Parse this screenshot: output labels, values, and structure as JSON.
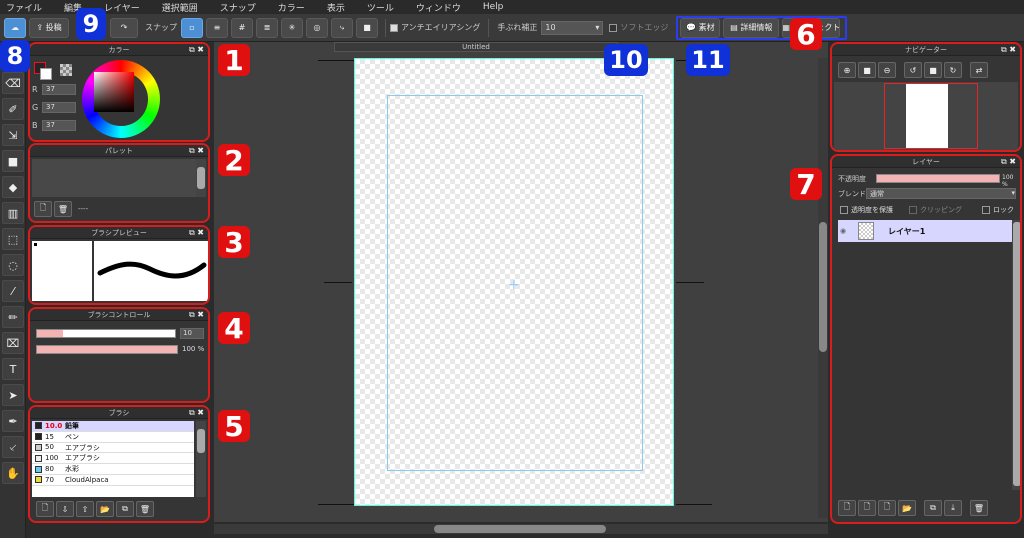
{
  "menu": [
    "ファイル",
    "編集",
    "レイヤー",
    "選択範囲",
    "スナップ",
    "カラー",
    "表示",
    "ツール",
    "ウィンドウ",
    "Help"
  ],
  "toolbar": {
    "post_label": "投稿",
    "snap_label": "スナップ",
    "antialias_label": "アンチエイリアシング",
    "stabilizer_label": "手ぶれ補正",
    "stabilizer_value": "10",
    "soft_edge_label": "ソフトエッジ",
    "material_label": "素材",
    "details_label": "詳細情報",
    "project_label": "プロジェクト"
  },
  "badges": {
    "b1": "1",
    "b2": "2",
    "b3": "3",
    "b4": "4",
    "b5": "5",
    "b6": "6",
    "b7": "7",
    "b8": "8",
    "b9": "9",
    "b10": "10",
    "b11": "11"
  },
  "color_panel": {
    "title": "カラー",
    "r_label": "R",
    "g_label": "G",
    "b_label": "B",
    "r": "37",
    "g": "37",
    "b": "37"
  },
  "palette_panel": {
    "title": "パレット",
    "value": "----"
  },
  "brush_preview_panel": {
    "title": "ブラシプレビュー"
  },
  "brush_control_panel": {
    "title": "ブラシコントロール",
    "size": "10",
    "opacity": "100 %"
  },
  "brush_panel": {
    "title": "ブラシ",
    "items": [
      {
        "size": "10.0",
        "name": "鉛筆",
        "color": "#222222",
        "selected": true
      },
      {
        "size": "15",
        "name": "ペン",
        "color": "#222222"
      },
      {
        "size": "50",
        "name": "エアブラシ",
        "color": "#cccccc"
      },
      {
        "size": "100",
        "name": "エアブラシ",
        "color": "#eeeeee"
      },
      {
        "size": "80",
        "name": "水彩",
        "color": "#66ccee"
      },
      {
        "size": "70",
        "name": "CloudAlpaca",
        "color": "#eedd33"
      }
    ]
  },
  "canvas": {
    "tab_title": "Untitled"
  },
  "navigator_panel": {
    "title": "ナビゲーター"
  },
  "layer_panel": {
    "title": "レイヤー",
    "opacity_label": "不透明度",
    "opacity_value": "100 %",
    "blend_label": "ブレンド",
    "blend_value": "通常",
    "protect_alpha_label": "透明度を保護",
    "clipping_label": "クリッピング",
    "lock_label": "ロック",
    "layer_name": "レイヤー1"
  },
  "colors": {
    "accent": "#4d8fd4",
    "badge_red": "#e01010",
    "badge_blue": "#1030d8"
  }
}
